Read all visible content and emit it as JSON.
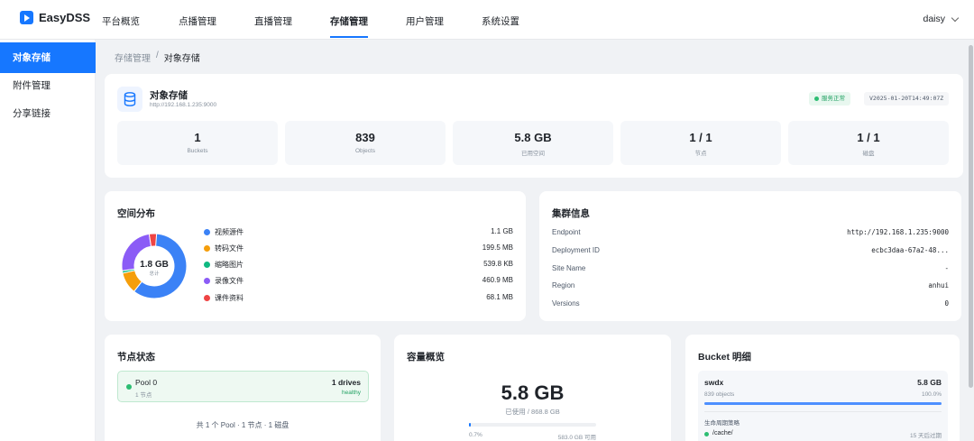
{
  "app": {
    "name": "EasyDSS",
    "user": "daisy"
  },
  "nav": [
    {
      "label": "平台概览"
    },
    {
      "label": "点播管理"
    },
    {
      "label": "直播管理"
    },
    {
      "label": "存储管理"
    },
    {
      "label": "用户管理"
    },
    {
      "label": "系统设置"
    }
  ],
  "nav_active": "存储管理",
  "sidebar": [
    {
      "label": "对象存储"
    },
    {
      "label": "附件管理"
    },
    {
      "label": "分享链接"
    }
  ],
  "breadcrumb": {
    "parent": "存储管理",
    "separator": "/",
    "current": "对象存储"
  },
  "overview": {
    "title": "对象存储",
    "address": "http://192.168.1.235:9000",
    "status": "服务正常",
    "version": "V2025-01-20T14:49:07Z",
    "stats": [
      {
        "value": "1",
        "label": "Buckets"
      },
      {
        "value": "839",
        "label": "Objects"
      },
      {
        "value": "5.8 GB",
        "label": "已用空间"
      },
      {
        "value": "1 / 1",
        "label": "节点"
      },
      {
        "value": "1 / 1",
        "label": "磁盘"
      }
    ]
  },
  "space": {
    "title": "空间分布",
    "center_value": "1.8 GB",
    "center_label": "总计"
  },
  "chart_data": {
    "type": "pie",
    "categories": [
      "视频源件",
      "转码文件",
      "缩略图片",
      "录像文件",
      "课件资料"
    ],
    "labels": [
      "1.1 GB",
      "199.5 MB",
      "539.8 KB",
      "460.9 MB",
      "68.1 MB"
    ],
    "values_mb": [
      1126.4,
      199.5,
      0.527,
      460.9,
      68.1
    ],
    "colors": [
      "#3b82f6",
      "#f59e0b",
      "#10b981",
      "#8b5cf6",
      "#ef4444"
    ],
    "donut": true
  },
  "cluster": {
    "title": "集群信息",
    "rows": [
      {
        "k": "Endpoint",
        "v": "http://192.168.1.235:9000"
      },
      {
        "k": "Deployment ID",
        "v": "ecbc3daa-67a2-48..."
      },
      {
        "k": "Site Name",
        "v": "-"
      },
      {
        "k": "Region",
        "v": "anhui"
      },
      {
        "k": "Versions",
        "v": "0"
      }
    ]
  },
  "nodes": {
    "title": "节点状态",
    "pool_name": "Pool 0",
    "pool_sub": "1 节点",
    "drives": "1 drives",
    "health": "healthy",
    "summary": "共 1 个 Pool · 1 节点 · 1 磁盘"
  },
  "capacity": {
    "title": "容量概览",
    "used": "5.8 GB",
    "sub": "已使用 / 868.8 GB",
    "percent_label": "0.7%",
    "available": "583.0 GB 可用",
    "fraction": 0.007
  },
  "bucket": {
    "title": "Bucket 明细",
    "name": "swdx",
    "size": "5.8 GB",
    "objects": "839 objects",
    "percent": "100.0%",
    "fraction": 1.0,
    "lifecycle_label": "生命周期策略",
    "path": "/cache/",
    "expire": "15 天后过期"
  }
}
